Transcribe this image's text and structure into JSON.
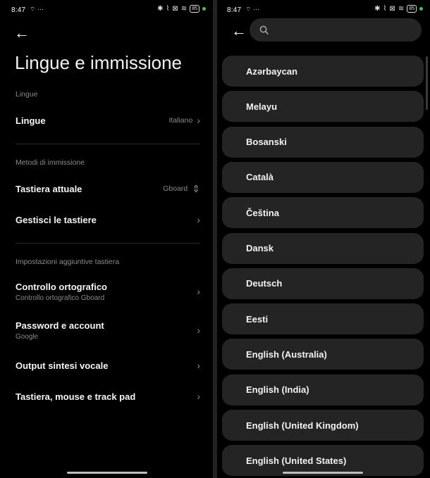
{
  "left": {
    "status": {
      "time": "8:47",
      "battery": "85"
    },
    "title": "Lingue e immissione",
    "sections": {
      "lingue_label": "Lingue",
      "metodi_label": "Metodi di immissione",
      "aggiuntive_label": "Impostazioni aggiuntive tastiera"
    },
    "rows": {
      "lingue": {
        "title": "Lingue",
        "value": "Italiano"
      },
      "tastiera_attuale": {
        "title": "Tastiera attuale",
        "value": "Gboard"
      },
      "gestisci": {
        "title": "Gestisci le tastiere"
      },
      "controllo": {
        "title": "Controllo ortografico",
        "subtitle": "Controllo ortografico Gboard"
      },
      "password": {
        "title": "Password e account",
        "subtitle": "Google"
      },
      "output": {
        "title": "Output sintesi vocale"
      },
      "tastiera_mouse": {
        "title": "Tastiera, mouse e track pad"
      }
    }
  },
  "right": {
    "status": {
      "time": "8:47",
      "battery": "85"
    },
    "search": {
      "placeholder": ""
    },
    "languages": [
      "Azərbaycan",
      "Melayu",
      "Bosanski",
      "Català",
      "Čeština",
      "Dansk",
      "Deutsch",
      "Eesti",
      "English (Australia)",
      "English (India)",
      "English (United Kingdom)",
      "English (United States)"
    ]
  },
  "colors": {
    "background": "#000000",
    "card": "#242424",
    "secondary_text": "#8a8a8a",
    "status_dot": "#3ec466"
  }
}
